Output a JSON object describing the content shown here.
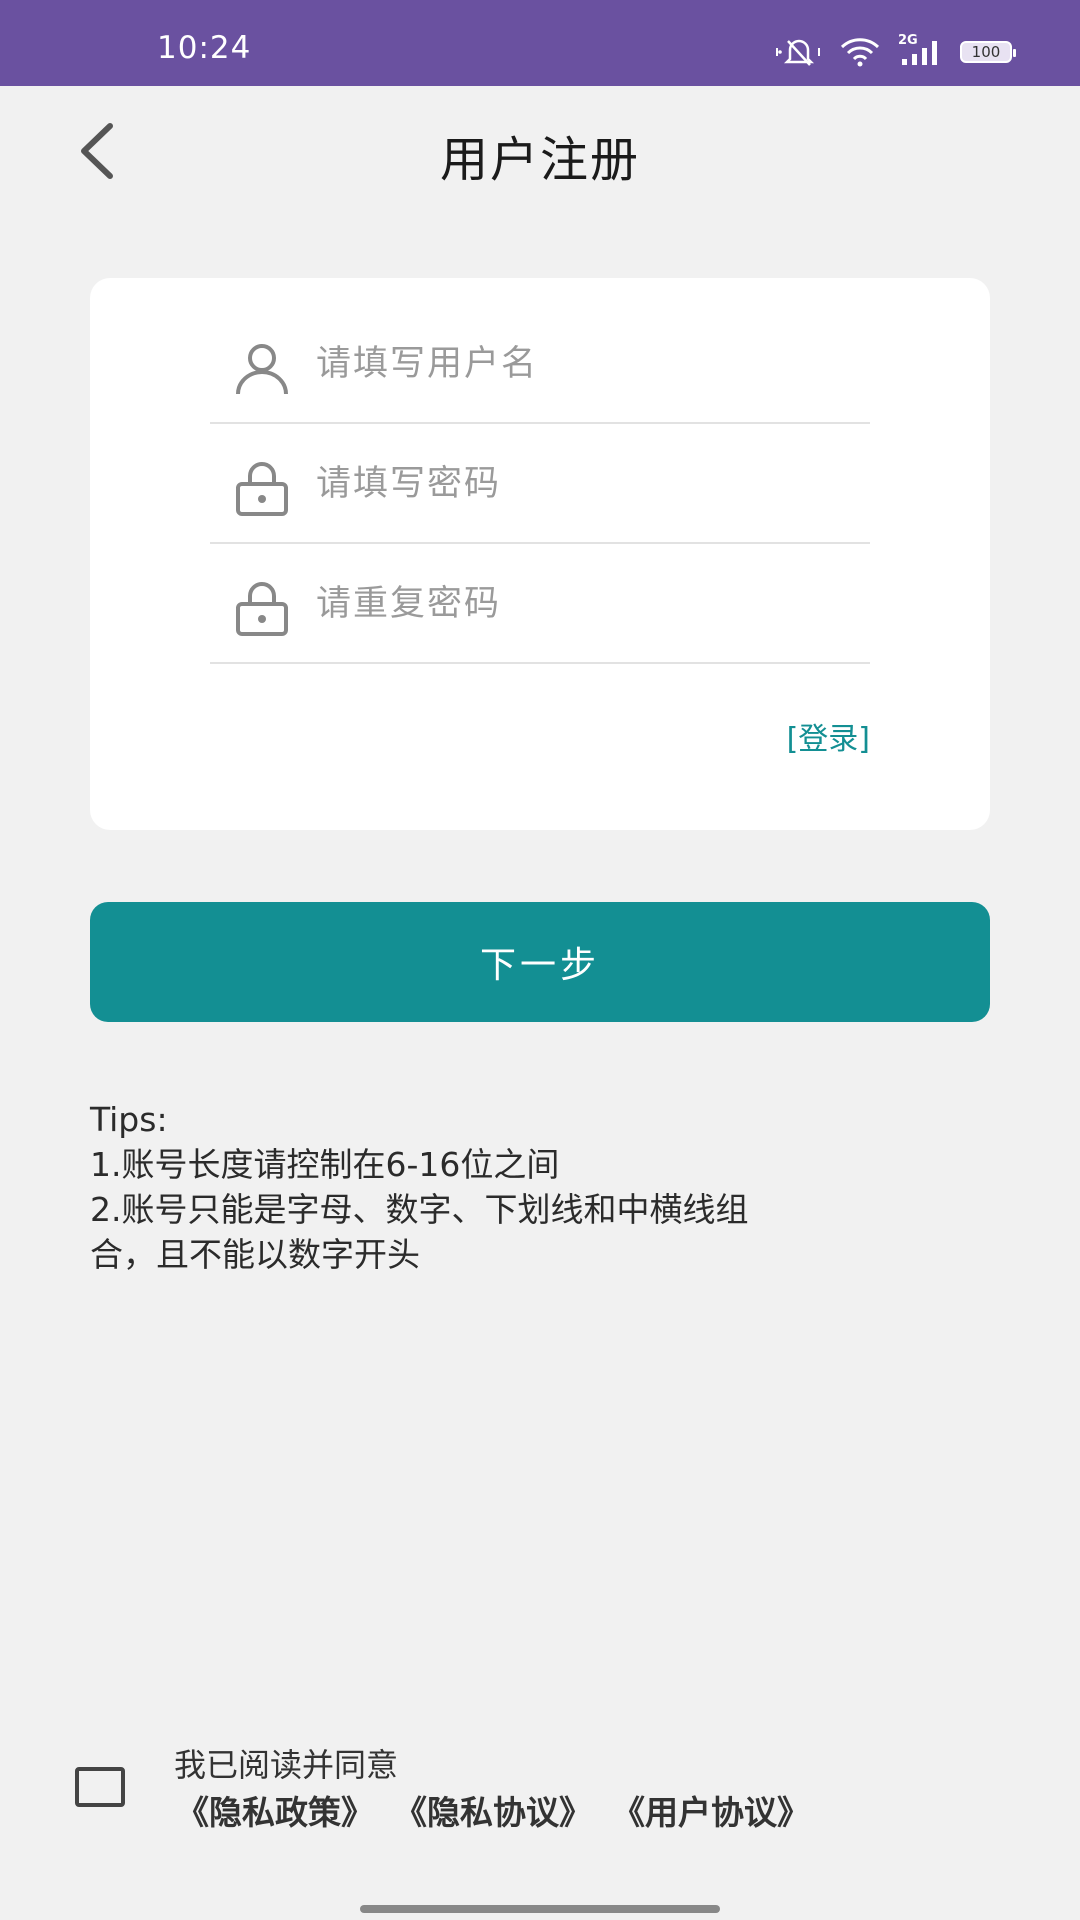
{
  "status_bar": {
    "time": "10:24",
    "signal_label": "2G",
    "battery": "100",
    "icons": [
      "mute-icon",
      "wifi-icon",
      "signal-icon",
      "battery-icon"
    ]
  },
  "header": {
    "title": "用户注册",
    "back_icon": "chevron-left-icon"
  },
  "form": {
    "username_placeholder": "请填写用户名",
    "password_placeholder": "请填写密码",
    "repeat_password_placeholder": "请重复密码",
    "login_link": "[登录]"
  },
  "actions": {
    "next_label": "下一步"
  },
  "tips": {
    "title": "Tips:",
    "line1": "1.账号长度请控制在6-16位之间",
    "line2": "2.账号只能是字母、数字、下划线和中横线组",
    "line3": "合，且不能以数字开头"
  },
  "agreement": {
    "text": "我已阅读并同意",
    "links": [
      "《隐私政策》",
      "《隐私协议》",
      "《用户协议》"
    ]
  },
  "colors": {
    "status_bar": "#6a51a0",
    "accent": "#138f93",
    "background": "#f1f1f1",
    "card": "#ffffff"
  }
}
